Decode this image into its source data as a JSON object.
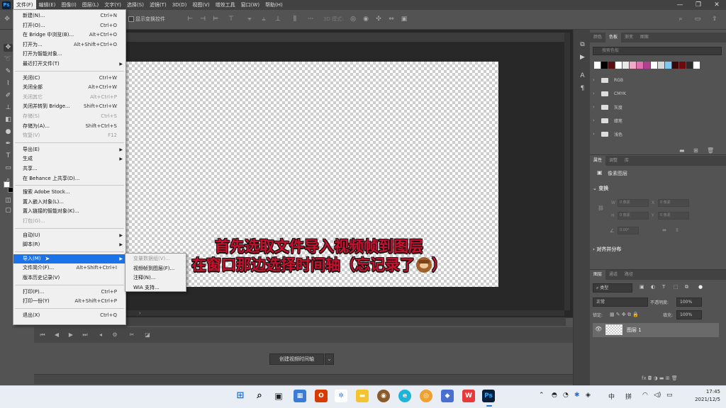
{
  "menubar": {
    "logo": "Ps",
    "items": [
      "文件(F)",
      "编辑(E)",
      "图像(I)",
      "图层(L)",
      "文字(Y)",
      "选择(S)",
      "滤镜(T)",
      "3D(D)",
      "视图(V)",
      "增效工具",
      "窗口(W)",
      "帮助(H)"
    ]
  },
  "options_bar": {
    "show_transform_label": "显示变换控件",
    "mode_3d_label": "3D 模式:"
  },
  "file_menu": {
    "items": [
      {
        "label": "新建(N)...",
        "shortcut": "Ctrl+N"
      },
      {
        "label": "打开(O)...",
        "shortcut": "Ctrl+O"
      },
      {
        "label": "在 Bridge 中浏览(B)...",
        "shortcut": "Alt+Ctrl+O"
      },
      {
        "label": "打开为...",
        "shortcut": "Alt+Shift+Ctrl+O"
      },
      {
        "label": "打开为智能对象...",
        "shortcut": ""
      },
      {
        "label": "最近打开文件(T)",
        "shortcut": "",
        "submenu": true
      },
      {
        "label": "关闭(C)",
        "shortcut": "Ctrl+W"
      },
      {
        "label": "关闭全部",
        "shortcut": "Alt+Ctrl+W"
      },
      {
        "label": "关闭其它",
        "shortcut": "Alt+Ctrl+P",
        "disabled": true
      },
      {
        "label": "关闭并转到 Bridge...",
        "shortcut": "Shift+Ctrl+W"
      },
      {
        "label": "存储(S)",
        "shortcut": "Ctrl+S",
        "disabled": true
      },
      {
        "label": "存储为(A)...",
        "shortcut": "Shift+Ctrl+S"
      },
      {
        "label": "恢复(V)",
        "shortcut": "F12",
        "disabled": true
      },
      {
        "label": "导出(E)",
        "shortcut": "",
        "submenu": true
      },
      {
        "label": "生成",
        "shortcut": "",
        "submenu": true
      },
      {
        "label": "共享...",
        "shortcut": ""
      },
      {
        "label": "在 Behance 上共享(D)...",
        "shortcut": ""
      },
      {
        "label": "搜索 Adobe Stock...",
        "shortcut": ""
      },
      {
        "label": "置入嵌入对象(L)...",
        "shortcut": ""
      },
      {
        "label": "置入链接的智能对象(K)...",
        "shortcut": ""
      },
      {
        "label": "打包(G)...",
        "shortcut": "",
        "disabled": true
      },
      {
        "label": "自动(U)",
        "shortcut": "",
        "submenu": true
      },
      {
        "label": "脚本(R)",
        "shortcut": "",
        "submenu": true
      },
      {
        "label": "导入(M)",
        "shortcut": "",
        "submenu": true,
        "highlighted": true
      },
      {
        "label": "文件简介(F)...",
        "shortcut": "Alt+Shift+Ctrl+I"
      },
      {
        "label": "版本历史记录(V)",
        "shortcut": ""
      },
      {
        "label": "打印(P)...",
        "shortcut": "Ctrl+P"
      },
      {
        "label": "打印一份(Y)",
        "shortcut": "Alt+Shift+Ctrl+P"
      },
      {
        "label": "退出(X)",
        "shortcut": "Ctrl+Q"
      }
    ]
  },
  "import_submenu": {
    "items": [
      {
        "label": "变量数据组(V)...",
        "disabled": true
      },
      {
        "label": "视频帧到图层(F)..."
      },
      {
        "label": "注释(N)..."
      },
      {
        "label": "WIA 支持..."
      }
    ]
  },
  "subtitle": {
    "line1": "首先选取文件导入视频帧到图层",
    "line2": "在窗口那边选择时间轴（忘记录了",
    "line2_end": "）"
  },
  "timeline": {
    "create_button": "创建视频时间轴"
  },
  "swatches_panel": {
    "tabs": [
      "颜色",
      "色板",
      "渐变",
      "图案"
    ],
    "search_placeholder": "搜索色板",
    "colors": [
      "#ffffff",
      "#000000",
      "#5a1010",
      "#ffffff",
      "#e8e8e8",
      "#f2a8c8",
      "#e070b0",
      "#b04090",
      "#ffffff",
      "#d8d8d8",
      "#80c8f0",
      "#3a0808",
      "#6a0a0a",
      "#2a2a2a",
      "#ffffff"
    ],
    "groups": [
      "RGB",
      "CMYK",
      "灰度",
      "蜡笔",
      "浅色"
    ]
  },
  "properties_panel": {
    "tabs": [
      "属性",
      "调整",
      "库"
    ],
    "pixel_layer_label": "像素图层",
    "transform_label": "变换",
    "w_label": "W",
    "h_label": "H",
    "x_label": "X",
    "y_label": "Y",
    "w_value": "0 像素",
    "h_value": "0 像素",
    "x_value": "0 像素",
    "y_value": "0 像素",
    "angle_value": "0.00°",
    "align_label": "对齐并分布"
  },
  "layers_panel": {
    "tabs": [
      "图层",
      "通道",
      "路径"
    ],
    "kind_filter": "类型",
    "blend_mode": "正常",
    "opacity_label": "不透明度:",
    "opacity_value": "100%",
    "lock_label": "锁定:",
    "fill_label": "填充:",
    "fill_value": "100%",
    "layer_name": "图层 1"
  },
  "taskbar": {
    "ime_label": "中",
    "ime_mode": "拼",
    "time": "17:45",
    "date": "2021/12/5"
  }
}
